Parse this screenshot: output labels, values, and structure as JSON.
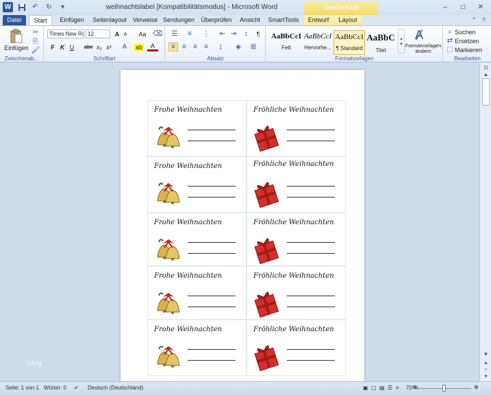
{
  "window": {
    "title": "weihnachtslabel [Kompatibilitätsmodus]  -  Microsoft Word",
    "context_tab_header": "Tabellentools",
    "minimize": "–",
    "maximize": "□",
    "close": "✕"
  },
  "quick_access": {
    "app_icon": "W",
    "save": "💾",
    "undo": "↶",
    "redo": "↻"
  },
  "tabs": [
    "Datei",
    "Start",
    "Einfügen",
    "Seitenlayout",
    "Verweise",
    "Sendungen",
    "Überprüfen",
    "Ansicht",
    "SmartTools",
    "Entwurf",
    "Layout"
  ],
  "ribbon": {
    "clipboard": {
      "paste_label": "Einfügen",
      "group_label": "Zwischenab..."
    },
    "font": {
      "name": "Times New Ro",
      "size": "12",
      "group_label": "Schriftart",
      "bold": "F",
      "italic": "K",
      "underline": "U",
      "strike": "abc",
      "sub": "x₂",
      "sup": "x²",
      "grow": "A",
      "shrink": "A",
      "case": "Aa"
    },
    "paragraph": {
      "group_label": "Absatz",
      "pilcrow": "¶"
    },
    "styles": {
      "group_label": "Formatvorlagen",
      "items": [
        {
          "sample": "AaBbCcI",
          "name": "Fett"
        },
        {
          "sample": "AaBbCcI",
          "name": "Hervorhe..."
        },
        {
          "sample": "AaBbCcI",
          "name": "¶ Standard"
        },
        {
          "sample": "AaBbC",
          "name": "Titel"
        }
      ],
      "change_styles": "Formatvorlagen ändern"
    },
    "editing": {
      "group_label": "Bearbeiten",
      "find": "Suchen",
      "replace": "Ersetzen",
      "select": "Markieren"
    }
  },
  "document": {
    "labels": [
      {
        "title": "Frohe Weihnachten",
        "icon": "bells-icon"
      },
      {
        "title": "Fröhliche Weihnachten",
        "icon": "gift-icon"
      },
      {
        "title": "Frohe Weihnachten",
        "icon": "bells-icon"
      },
      {
        "title": "Fröhliche Weihnachten",
        "icon": "gift-icon"
      },
      {
        "title": "Frohe Weihnachten",
        "icon": "bells-icon"
      },
      {
        "title": "Fröhliche Weihnachten",
        "icon": "gift-icon"
      },
      {
        "title": "Frohe Weihnachten",
        "icon": "bells-icon"
      },
      {
        "title": "Fröhliche Weihnachten",
        "icon": "gift-icon"
      },
      {
        "title": "Frohe Weihnachten",
        "icon": "bells-icon"
      },
      {
        "title": "Fröhliche Weihnachten",
        "icon": "gift-icon"
      }
    ]
  },
  "watermark": "blog",
  "statusbar": {
    "page": "Seite: 1 von 1",
    "words": "Wörter: 0",
    "language": "Deutsch (Deutschland)",
    "zoom": "70 %",
    "zoom_level": 0.7
  }
}
